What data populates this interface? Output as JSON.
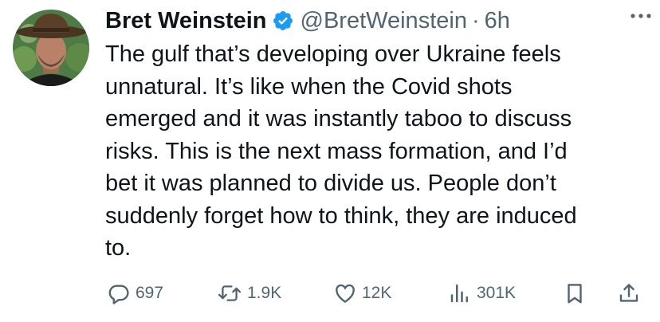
{
  "author": {
    "name": "Bret Weinstein",
    "handle": "@BretWeinstein",
    "separator": "·",
    "time": "6h"
  },
  "tweet": {
    "text": "The gulf that’s developing over Ukraine feels\nunnatural. It’s like when the Covid shots\nemerged and it was instantly taboo to discuss\nrisks. This is the next mass formation, and I’d\nbet it was planned to divide us. People don’t\nsuddenly forget how to think, they are induced\nto."
  },
  "stats": {
    "replies": "697",
    "reposts": "1.9K",
    "likes": "12K",
    "views": "301K"
  },
  "colors": {
    "verified": "#1d9bf0",
    "muted": "#536471",
    "text": "#0f1419"
  },
  "icons": {
    "more": "more-icon",
    "verified": "verified-badge-icon",
    "reply": "reply-icon",
    "repost": "repost-icon",
    "like": "like-icon",
    "views": "views-icon",
    "bookmark": "bookmark-icon",
    "share": "share-icon"
  }
}
